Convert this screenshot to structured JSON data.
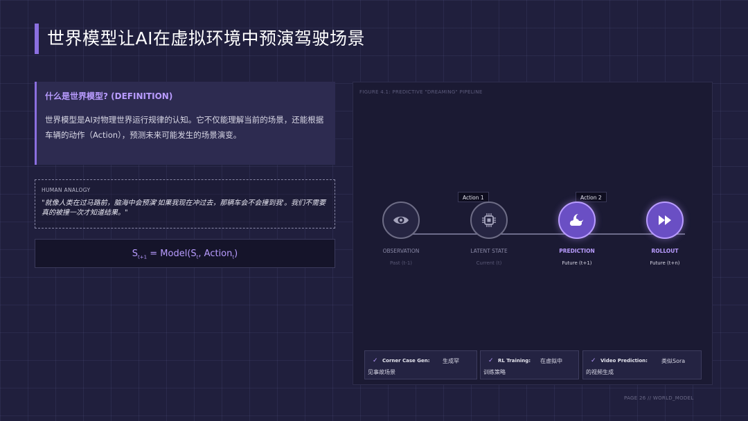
{
  "title": "世界模型让AI在虚拟环境中预演驾驶场景",
  "definition": {
    "heading": "什么是世界模型? (DEFINITION)",
    "body": "世界模型是AI对物理世界运行规律的认知。它不仅能理解当前的场景，还能根据车辆的动作（Action），预测未来可能发生的场景演变。"
  },
  "analogy": {
    "label": "HUMAN ANALOGY",
    "text": "\"就像人类在过马路前，脑海中会预演'如果我现在冲过去，那辆车会不会撞到我'。我们不需要真的被撞一次才知道结果。\""
  },
  "formula": {
    "s": "S",
    "s_sub": "t+1",
    "eq": " = Model(S",
    "st_sub": "t",
    "comma": ", Action",
    "a_sub": "t",
    "close": ")"
  },
  "figure": {
    "caption": "FIGURE 4.1: PREDICTIVE \"DREAMING\" PIPELINE",
    "actions": [
      "Action 1",
      "Action 2"
    ],
    "stages": [
      {
        "label": "OBSERVATION",
        "sub": "Past (t-1)",
        "icon": "eye-icon",
        "active": false
      },
      {
        "label": "LATENT STATE",
        "sub": "Current (t)",
        "icon": "chip-icon",
        "active": false
      },
      {
        "label": "PREDICTION",
        "sub": "Future (t+1)",
        "icon": "cloud-moon-icon",
        "active": true
      },
      {
        "label": "ROLLOUT",
        "sub": "Future (t+n)",
        "icon": "fast-forward-icon",
        "active": true
      }
    ]
  },
  "cards": [
    {
      "key": "Corner Case Gen:",
      "val1": "生成罕",
      "val2": "见事故场景"
    },
    {
      "key": "RL Training:",
      "val1": "在虚拟中",
      "val2": "训练策略"
    },
    {
      "key": "Video Prediction:",
      "val1": "类似Sora",
      "val2": "的视频生成"
    }
  ],
  "footer": "PAGE 26 // WORLD_MODEL",
  "colors": {
    "accent": "#8b6fe0",
    "highlight": "#b99cff",
    "background": "#201f3d"
  }
}
